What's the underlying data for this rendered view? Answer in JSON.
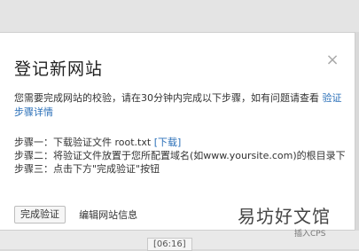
{
  "dialog": {
    "title": "登记新网站",
    "close_glyph": "×",
    "desc_prefix": "您需要完成网站的校验，请在30分钟内完成以下步骤，如有问题请查看",
    "desc_link": "验证步骤详情",
    "steps": {
      "s1_text": "步骤一：下载验证文件 root.txt",
      "s1_link": "[下载]",
      "s2_text": "步骤二：将验证文件放置于您所配置域名(如www.yoursite.com)的根目录下",
      "s3_text": "步骤三：点击下方\"完成验证\"按钮"
    },
    "complete_button": "完成验证",
    "edit_link": "编辑网站信息"
  },
  "background": {
    "timecode": "[06:16]"
  },
  "watermark": {
    "text": "易坊好文馆",
    "subtext": "插入CPS"
  },
  "colors": {
    "link": "#2a6fb8"
  }
}
